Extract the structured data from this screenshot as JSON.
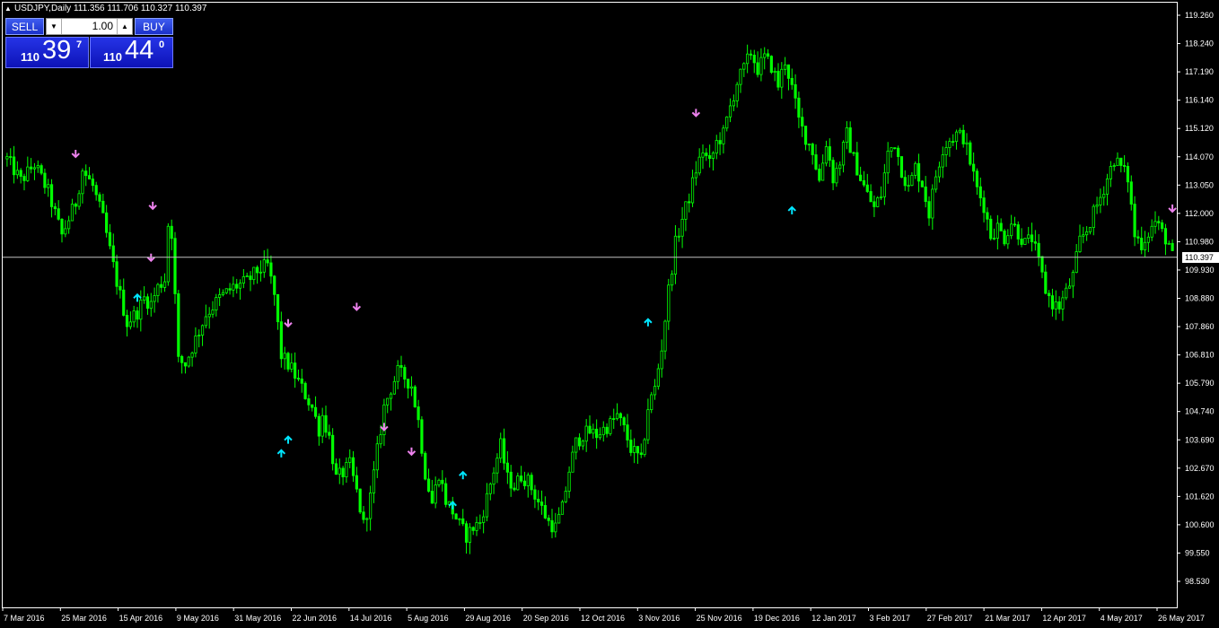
{
  "window": {
    "title": "USDJPY,Daily  111.356 111.706 110.327 110.397",
    "collapse_icon": "triangle-up-icon"
  },
  "trade_panel": {
    "sell_label": "SELL",
    "buy_label": "BUY",
    "lot_value": "1.00",
    "sell_quote": {
      "prefix": "110",
      "main": "39",
      "sup": "7"
    },
    "buy_quote": {
      "prefix": "110",
      "main": "44",
      "sup": "0"
    },
    "colors": {
      "button": "#2a43dd",
      "quote": "#1a22cc"
    }
  },
  "current_price_label": "110.397",
  "chart_data": {
    "type": "candlestick",
    "symbol": "USDJPY",
    "timeframe": "Daily",
    "ylim": [
      98.53,
      119.26
    ],
    "y_ticks": [
      "119.260",
      "118.240",
      "117.190",
      "116.140",
      "115.120",
      "114.070",
      "113.050",
      "112.000",
      "110.980",
      "109.930",
      "108.880",
      "107.860",
      "106.810",
      "105.790",
      "104.740",
      "103.690",
      "102.670",
      "101.620",
      "100.600",
      "99.550",
      "98.530"
    ],
    "x_ticks": [
      "7 Mar 2016",
      "25 Mar 2016",
      "15 Apr 2016",
      "9 May 2016",
      "31 May 2016",
      "22 Jun 2016",
      "14 Jul 2016",
      "5 Aug 2016",
      "29 Aug 2016",
      "20 Sep 2016",
      "12 Oct 2016",
      "3 Nov 2016",
      "25 Nov 2016",
      "19 Dec 2016",
      "12 Jan 2017",
      "3 Feb 2017",
      "27 Feb 2017",
      "21 Mar 2017",
      "12 Apr 2017",
      "4 May 2017",
      "26 May 2017"
    ],
    "current_price": 110.397,
    "bar_color": "#00ff00",
    "background": "#000000",
    "close_path": [
      [
        0,
        114.0
      ],
      [
        4,
        113.2
      ],
      [
        8,
        113.8
      ],
      [
        12,
        112.8
      ],
      [
        16,
        111.2
      ],
      [
        20,
        112.4
      ],
      [
        22,
        113.6
      ],
      [
        25,
        113.0
      ],
      [
        28,
        111.8
      ],
      [
        32,
        109.5
      ],
      [
        35,
        108.0
      ],
      [
        38,
        108.4
      ],
      [
        40,
        108.9
      ],
      [
        42,
        108.7
      ],
      [
        44,
        109.3
      ],
      [
        46,
        109.6
      ],
      [
        47,
        111.6
      ],
      [
        48,
        111.3
      ],
      [
        50,
        106.6
      ],
      [
        52,
        106.5
      ],
      [
        55,
        107.4
      ],
      [
        58,
        108.3
      ],
      [
        62,
        108.9
      ],
      [
        66,
        109.3
      ],
      [
        70,
        109.5
      ],
      [
        73,
        109.9
      ],
      [
        76,
        110.1
      ],
      [
        78,
        109.0
      ],
      [
        80,
        106.8
      ],
      [
        83,
        106.3
      ],
      [
        86,
        105.6
      ],
      [
        89,
        104.9
      ],
      [
        91,
        104.1
      ],
      [
        92,
        104.6
      ],
      [
        94,
        103.8
      ],
      [
        96,
        102.3
      ],
      [
        98,
        102.5
      ],
      [
        100,
        102.8
      ],
      [
        102,
        101.8
      ],
      [
        104,
        100.6
      ],
      [
        106,
        101.6
      ],
      [
        108,
        103.3
      ],
      [
        110,
        104.9
      ],
      [
        112,
        105.6
      ],
      [
        114,
        106.2
      ],
      [
        116,
        106.0
      ],
      [
        118,
        105.7
      ],
      [
        120,
        104.4
      ],
      [
        122,
        102.5
      ],
      [
        124,
        101.4
      ],
      [
        126,
        102.5
      ],
      [
        128,
        101.5
      ],
      [
        130,
        101.1
      ],
      [
        132,
        100.6
      ],
      [
        134,
        100.2
      ],
      [
        136,
        100.5
      ],
      [
        138,
        100.7
      ],
      [
        140,
        101.6
      ],
      [
        142,
        102.6
      ],
      [
        144,
        103.5
      ],
      [
        146,
        102.3
      ],
      [
        148,
        102.0
      ],
      [
        150,
        102.4
      ],
      [
        152,
        102.2
      ],
      [
        154,
        101.7
      ],
      [
        156,
        101.2
      ],
      [
        158,
        100.7
      ],
      [
        160,
        100.5
      ],
      [
        162,
        101.2
      ],
      [
        164,
        102.6
      ],
      [
        166,
        103.6
      ],
      [
        168,
        103.9
      ],
      [
        170,
        104.0
      ],
      [
        172,
        103.9
      ],
      [
        174,
        104.1
      ],
      [
        176,
        104.3
      ],
      [
        178,
        104.6
      ],
      [
        180,
        104.1
      ],
      [
        182,
        103.4
      ],
      [
        184,
        103.1
      ],
      [
        185,
        102.9
      ],
      [
        187,
        104.9
      ],
      [
        189,
        105.6
      ],
      [
        191,
        107.1
      ],
      [
        193,
        109.2
      ],
      [
        195,
        110.9
      ],
      [
        197,
        111.8
      ],
      [
        199,
        112.6
      ],
      [
        201,
        113.6
      ],
      [
        203,
        114.3
      ],
      [
        205,
        113.8
      ],
      [
        207,
        114.6
      ],
      [
        209,
        114.9
      ],
      [
        211,
        115.9
      ],
      [
        213,
        116.8
      ],
      [
        215,
        117.3
      ],
      [
        217,
        117.9
      ],
      [
        219,
        117.3
      ],
      [
        221,
        117.7
      ],
      [
        223,
        117.4
      ],
      [
        225,
        116.7
      ],
      [
        227,
        117.6
      ],
      [
        229,
        116.6
      ],
      [
        231,
        115.4
      ],
      [
        233,
        114.8
      ],
      [
        235,
        114.3
      ],
      [
        237,
        113.2
      ],
      [
        239,
        114.6
      ],
      [
        241,
        113.3
      ],
      [
        243,
        113.9
      ],
      [
        245,
        114.9
      ],
      [
        247,
        114.0
      ],
      [
        249,
        113.3
      ],
      [
        251,
        112.7
      ],
      [
        253,
        112.2
      ],
      [
        255,
        112.7
      ],
      [
        257,
        114.2
      ],
      [
        259,
        114.6
      ],
      [
        261,
        113.6
      ],
      [
        263,
        112.9
      ],
      [
        265,
        113.7
      ],
      [
        267,
        113.1
      ],
      [
        269,
        112.0
      ],
      [
        271,
        113.4
      ],
      [
        273,
        114.4
      ],
      [
        275,
        114.7
      ],
      [
        277,
        114.9
      ],
      [
        279,
        114.8
      ],
      [
        281,
        113.9
      ],
      [
        283,
        112.9
      ],
      [
        285,
        112.3
      ],
      [
        287,
        111.2
      ],
      [
        289,
        111.5
      ],
      [
        291,
        111.1
      ],
      [
        293,
        111.7
      ],
      [
        295,
        111.3
      ],
      [
        297,
        110.9
      ],
      [
        299,
        111.1
      ],
      [
        301,
        110.2
      ],
      [
        303,
        109.2
      ],
      [
        305,
        108.7
      ],
      [
        307,
        108.6
      ],
      [
        309,
        109.1
      ],
      [
        311,
        109.7
      ],
      [
        313,
        111.0
      ],
      [
        315,
        111.4
      ],
      [
        317,
        112.0
      ],
      [
        319,
        112.6
      ],
      [
        321,
        113.3
      ],
      [
        323,
        114.0
      ],
      [
        325,
        113.7
      ],
      [
        327,
        113.3
      ],
      [
        329,
        111.2
      ],
      [
        331,
        110.9
      ],
      [
        333,
        111.3
      ],
      [
        335,
        111.7
      ],
      [
        337,
        111.3
      ],
      [
        339,
        110.9
      ],
      [
        340,
        110.4
      ]
    ],
    "markers": [
      {
        "type": "down",
        "x": 20,
        "price": 114.2
      },
      {
        "type": "down",
        "x": 42,
        "price": 110.4
      },
      {
        "type": "down",
        "x": 42.5,
        "price": 112.3
      },
      {
        "type": "up",
        "x": 38,
        "price": 108.9
      },
      {
        "type": "down",
        "x": 82,
        "price": 108.0
      },
      {
        "type": "down",
        "x": 102,
        "price": 108.6
      },
      {
        "type": "up",
        "x": 80,
        "price": 103.2
      },
      {
        "type": "up",
        "x": 82,
        "price": 103.7
      },
      {
        "type": "down",
        "x": 110,
        "price": 104.2
      },
      {
        "type": "down",
        "x": 118,
        "price": 103.3
      },
      {
        "type": "up",
        "x": 130,
        "price": 101.3
      },
      {
        "type": "up",
        "x": 133,
        "price": 102.4
      },
      {
        "type": "up",
        "x": 187,
        "price": 108.0
      },
      {
        "type": "down",
        "x": 201,
        "price": 115.7
      },
      {
        "type": "up",
        "x": 229,
        "price": 112.1
      },
      {
        "type": "down",
        "x": 340,
        "price": 112.2
      }
    ]
  }
}
